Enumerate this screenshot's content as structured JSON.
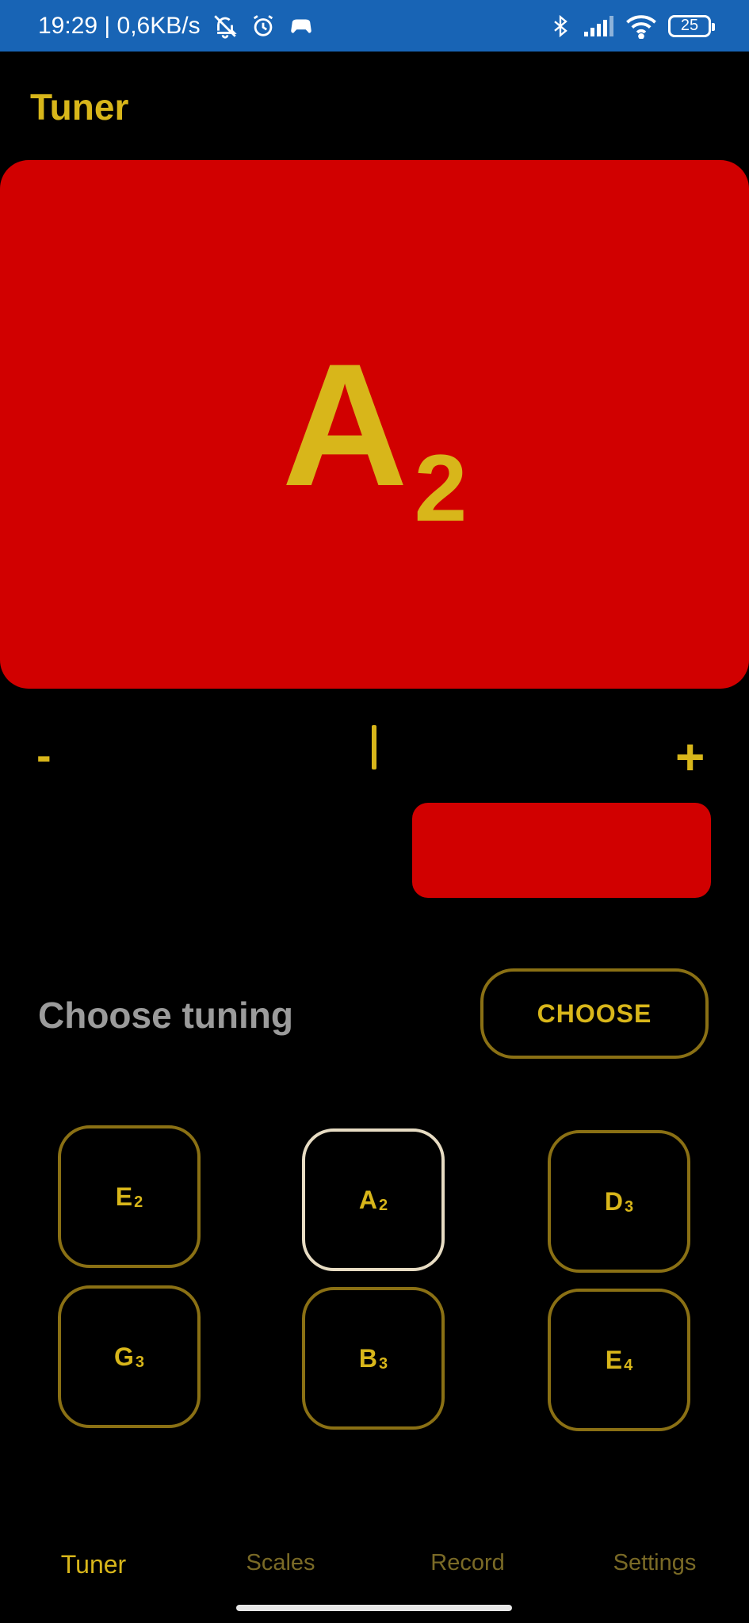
{
  "status_bar": {
    "time_speed": "19:29 | 0,6KB/s",
    "battery": "25",
    "icons": [
      "notifications-off-icon",
      "alarm-icon",
      "game-icon",
      "bluetooth-icon",
      "signal-icon",
      "wifi-icon",
      "battery-icon"
    ]
  },
  "header": {
    "title": "Tuner"
  },
  "note_display": {
    "letter": "A",
    "octave": "2"
  },
  "scale": {
    "minus": "-",
    "plus": "+"
  },
  "tuning": {
    "label": "Choose tuning",
    "button": "CHOOSE"
  },
  "strings": [
    {
      "letter": "E",
      "octave": "2",
      "active": false
    },
    {
      "letter": "A",
      "octave": "2",
      "active": true
    },
    {
      "letter": "D",
      "octave": "3",
      "active": false
    },
    {
      "letter": "G",
      "octave": "3",
      "active": false
    },
    {
      "letter": "B",
      "octave": "3",
      "active": false
    },
    {
      "letter": "E",
      "octave": "4",
      "active": false
    }
  ],
  "nav": [
    {
      "label": "Tuner",
      "active": true
    },
    {
      "label": "Scales",
      "active": false
    },
    {
      "label": "Record",
      "active": false
    },
    {
      "label": "Settings",
      "active": false
    }
  ],
  "colors": {
    "accent": "#d8b61a",
    "alert_red": "#d10000",
    "status_bar": "#1864b5",
    "active_outline": "#e7dcc3"
  }
}
